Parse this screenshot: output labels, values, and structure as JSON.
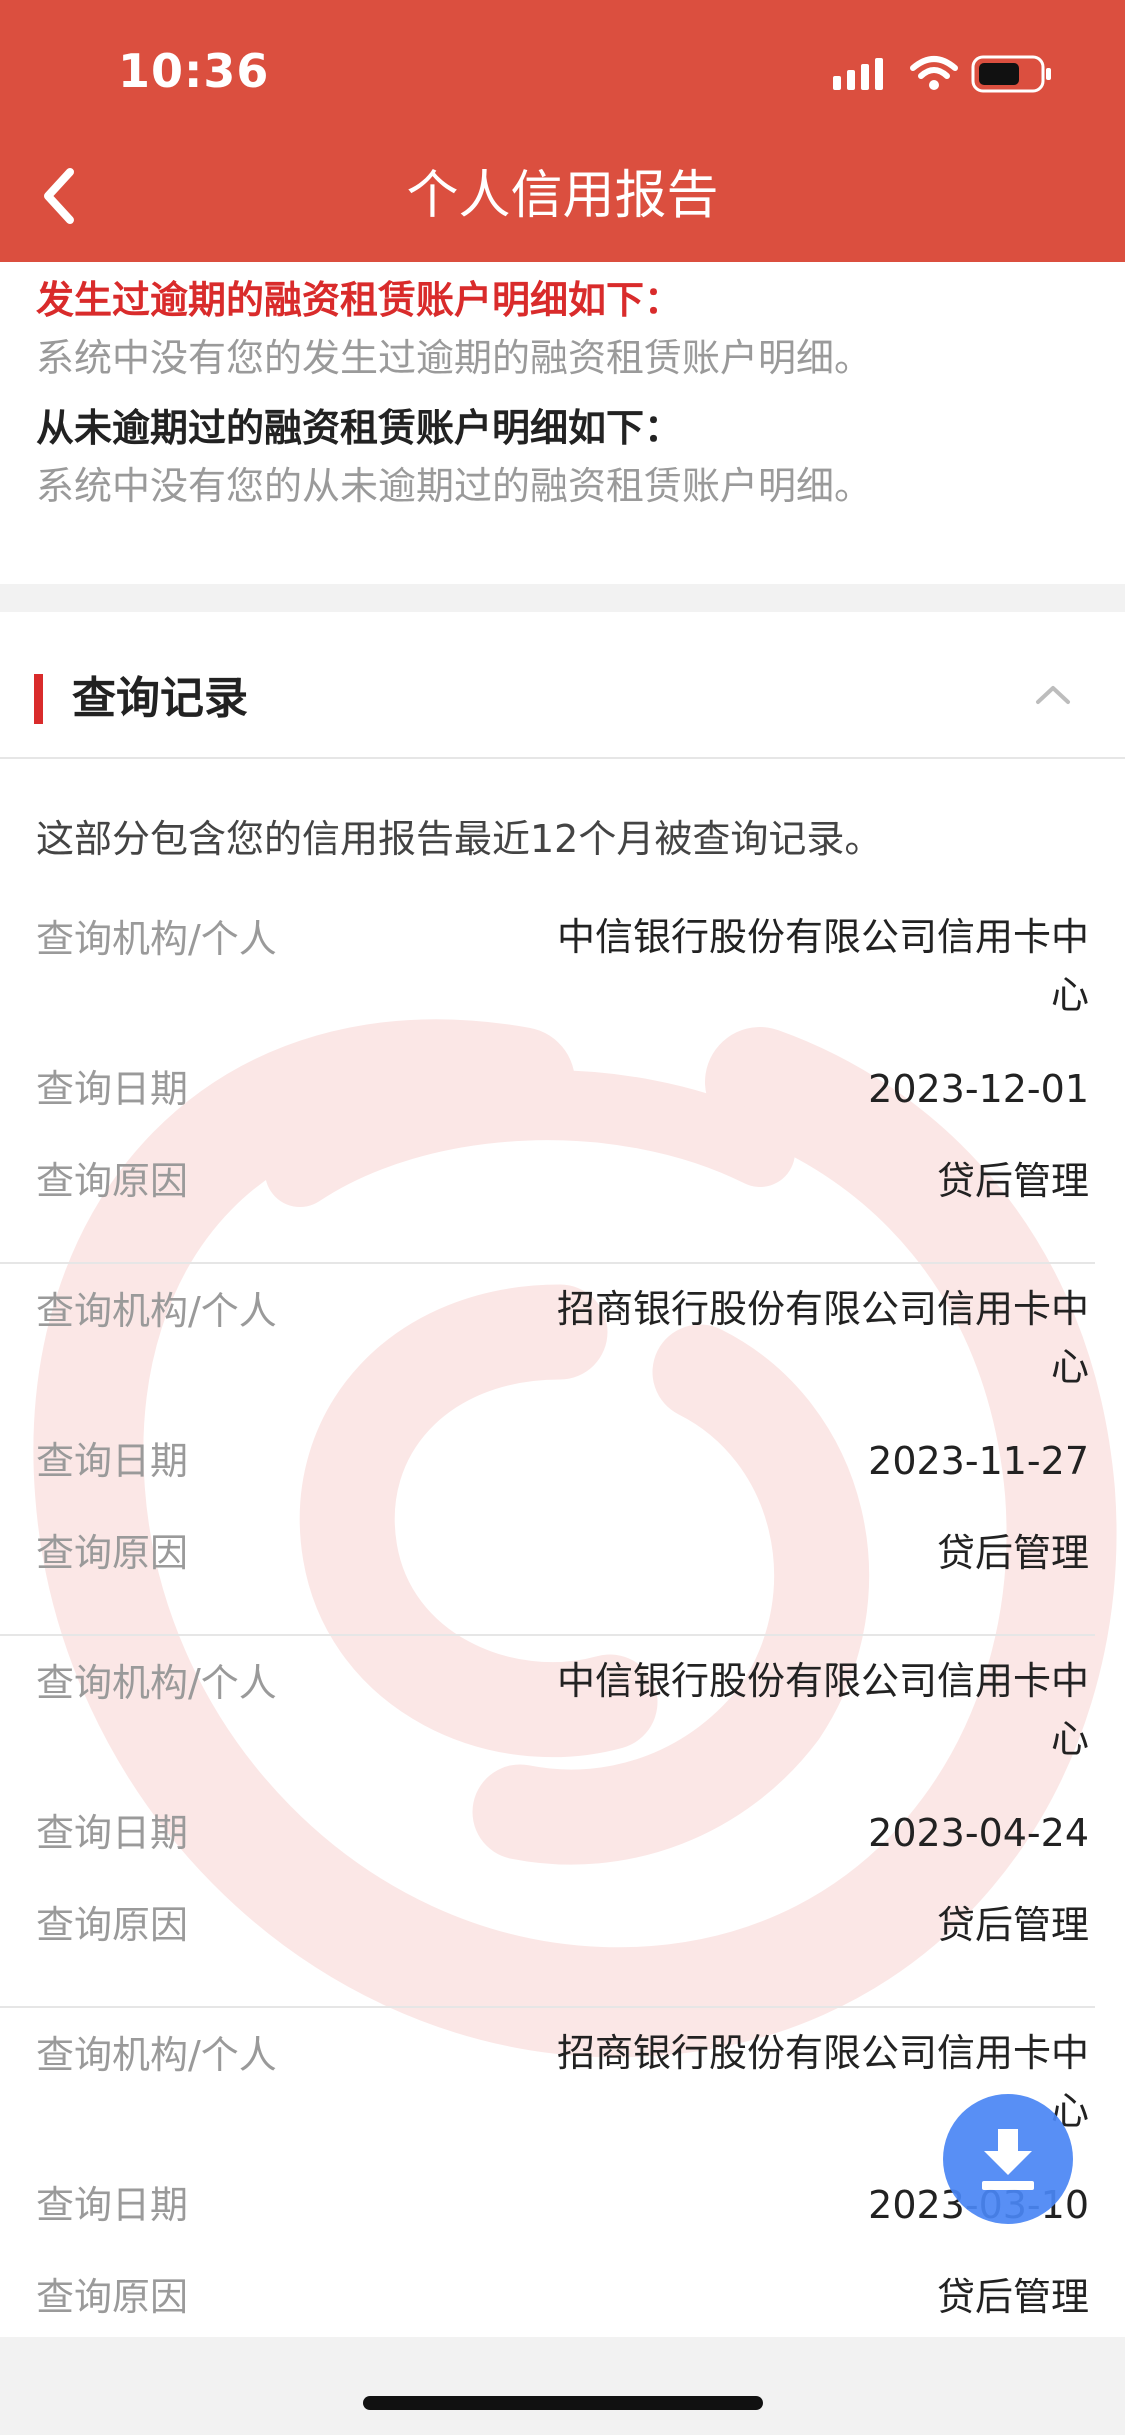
{
  "status_bar": {
    "time": "10:36",
    "icons": [
      "cellular-signal-icon",
      "wifi-icon",
      "battery-icon"
    ]
  },
  "nav": {
    "title": "个人信用报告",
    "back_icon": "chevron-left-icon"
  },
  "leasing_section": {
    "overdue_title": "发生过逾期的融资租赁账户明细如下：",
    "overdue_text": "系统中没有您的发生过逾期的融资租赁账户明细。",
    "never_overdue_title": "从未逾期过的融资租赁账户明细如下：",
    "never_overdue_text": "系统中没有您的从未逾期过的融资租赁账户明细。"
  },
  "query_section": {
    "title": "查询记录",
    "collapse_icon": "chevron-up-icon",
    "intro": "这部分包含您的信用报告最近12个月被查询记录。",
    "records": [
      {
        "institution_label": "查询机构/个人",
        "institution": "中信银行股份有限公司信用卡中心",
        "date_label": "查询日期",
        "date": "2023-12-01",
        "reason_label": "查询原因",
        "reason": "贷后管理"
      },
      {
        "institution_label": "查询机构/个人",
        "institution": "招商银行股份有限公司信用卡中心",
        "date_label": "查询日期",
        "date": "2023-11-27",
        "reason_label": "查询原因",
        "reason": "贷后管理"
      },
      {
        "institution_label": "查询机构/个人",
        "institution": "中信银行股份有限公司信用卡中心",
        "date_label": "查询日期",
        "date": "2023-04-24",
        "reason_label": "查询原因",
        "reason": "贷后管理"
      },
      {
        "institution_label": "查询机构/个人",
        "institution": "招商银行股份有限公司信用卡中心",
        "date_label": "查询日期",
        "date": "2023-03-10",
        "reason_label": "查询原因",
        "reason": "贷后管理"
      }
    ]
  },
  "floating": {
    "download_icon": "download-icon"
  },
  "colors": {
    "header_bg": "#db4f3f",
    "overdue_title": "#d92b2b",
    "accent_bar": "#d92b2b",
    "download_button": "#4a86f5",
    "watermark": "#fbe7e6"
  }
}
